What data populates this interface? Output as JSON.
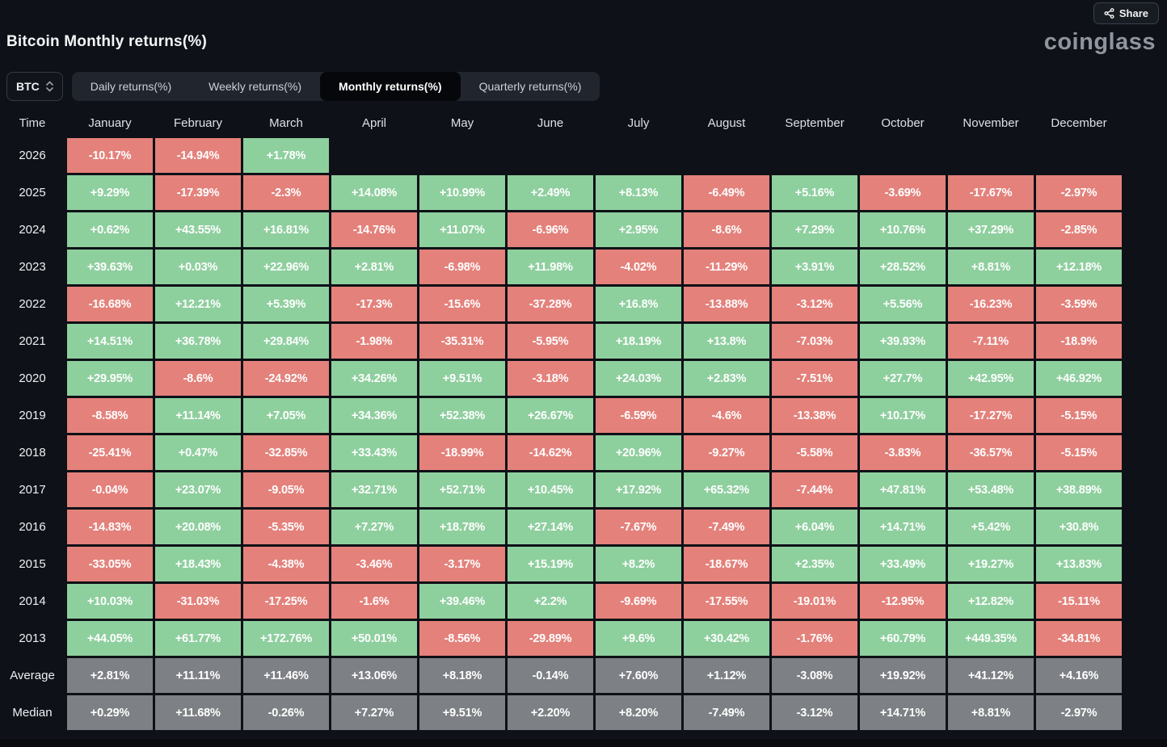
{
  "page": {
    "title": "Bitcoin Monthly returns(%)",
    "logo_text": "coinglass",
    "share_label": "Share"
  },
  "toolbar": {
    "symbol": "BTC",
    "tabs": [
      {
        "label": "Daily returns(%)",
        "slug": "daily-returns",
        "active": false
      },
      {
        "label": "Weekly returns(%)",
        "slug": "weekly-returns",
        "active": false
      },
      {
        "label": "Monthly returns(%)",
        "slug": "monthly-returns",
        "active": true
      },
      {
        "label": "Quarterly returns(%)",
        "slug": "quarterly-returns",
        "active": false
      }
    ]
  },
  "colors": {
    "positive": "#8ecf9e",
    "negative": "#e4817b",
    "summary": "#7d8084",
    "background": "#0e1117"
  },
  "chart_data": {
    "type": "heatmap",
    "title": "Bitcoin Monthly returns(%)",
    "columns": [
      "Time",
      "January",
      "February",
      "March",
      "April",
      "May",
      "June",
      "July",
      "August",
      "September",
      "October",
      "November",
      "December"
    ],
    "rows": [
      {
        "label": "2026",
        "kind": "year",
        "values": [
          "-10.17%",
          "-14.94%",
          "+1.78%",
          "",
          "",
          "",
          "",
          "",
          "",
          "",
          "",
          ""
        ]
      },
      {
        "label": "2025",
        "kind": "year",
        "values": [
          "+9.29%",
          "-17.39%",
          "-2.3%",
          "+14.08%",
          "+10.99%",
          "+2.49%",
          "+8.13%",
          "-6.49%",
          "+5.16%",
          "-3.69%",
          "-17.67%",
          "-2.97%"
        ]
      },
      {
        "label": "2024",
        "kind": "year",
        "values": [
          "+0.62%",
          "+43.55%",
          "+16.81%",
          "-14.76%",
          "+11.07%",
          "-6.96%",
          "+2.95%",
          "-8.6%",
          "+7.29%",
          "+10.76%",
          "+37.29%",
          "-2.85%"
        ]
      },
      {
        "label": "2023",
        "kind": "year",
        "values": [
          "+39.63%",
          "+0.03%",
          "+22.96%",
          "+2.81%",
          "-6.98%",
          "+11.98%",
          "-4.02%",
          "-11.29%",
          "+3.91%",
          "+28.52%",
          "+8.81%",
          "+12.18%"
        ]
      },
      {
        "label": "2022",
        "kind": "year",
        "values": [
          "-16.68%",
          "+12.21%",
          "+5.39%",
          "-17.3%",
          "-15.6%",
          "-37.28%",
          "+16.8%",
          "-13.88%",
          "-3.12%",
          "+5.56%",
          "-16.23%",
          "-3.59%"
        ]
      },
      {
        "label": "2021",
        "kind": "year",
        "values": [
          "+14.51%",
          "+36.78%",
          "+29.84%",
          "-1.98%",
          "-35.31%",
          "-5.95%",
          "+18.19%",
          "+13.8%",
          "-7.03%",
          "+39.93%",
          "-7.11%",
          "-18.9%"
        ]
      },
      {
        "label": "2020",
        "kind": "year",
        "values": [
          "+29.95%",
          "-8.6%",
          "-24.92%",
          "+34.26%",
          "+9.51%",
          "-3.18%",
          "+24.03%",
          "+2.83%",
          "-7.51%",
          "+27.7%",
          "+42.95%",
          "+46.92%"
        ]
      },
      {
        "label": "2019",
        "kind": "year",
        "values": [
          "-8.58%",
          "+11.14%",
          "+7.05%",
          "+34.36%",
          "+52.38%",
          "+26.67%",
          "-6.59%",
          "-4.6%",
          "-13.38%",
          "+10.17%",
          "-17.27%",
          "-5.15%"
        ]
      },
      {
        "label": "2018",
        "kind": "year",
        "values": [
          "-25.41%",
          "+0.47%",
          "-32.85%",
          "+33.43%",
          "-18.99%",
          "-14.62%",
          "+20.96%",
          "-9.27%",
          "-5.58%",
          "-3.83%",
          "-36.57%",
          "-5.15%"
        ]
      },
      {
        "label": "2017",
        "kind": "year",
        "values": [
          "-0.04%",
          "+23.07%",
          "-9.05%",
          "+32.71%",
          "+52.71%",
          "+10.45%",
          "+17.92%",
          "+65.32%",
          "-7.44%",
          "+47.81%",
          "+53.48%",
          "+38.89%"
        ]
      },
      {
        "label": "2016",
        "kind": "year",
        "values": [
          "-14.83%",
          "+20.08%",
          "-5.35%",
          "+7.27%",
          "+18.78%",
          "+27.14%",
          "-7.67%",
          "-7.49%",
          "+6.04%",
          "+14.71%",
          "+5.42%",
          "+30.8%"
        ]
      },
      {
        "label": "2015",
        "kind": "year",
        "values": [
          "-33.05%",
          "+18.43%",
          "-4.38%",
          "-3.46%",
          "-3.17%",
          "+15.19%",
          "+8.2%",
          "-18.67%",
          "+2.35%",
          "+33.49%",
          "+19.27%",
          "+13.83%"
        ]
      },
      {
        "label": "2014",
        "kind": "year",
        "values": [
          "+10.03%",
          "-31.03%",
          "-17.25%",
          "-1.6%",
          "+39.46%",
          "+2.2%",
          "-9.69%",
          "-17.55%",
          "-19.01%",
          "-12.95%",
          "+12.82%",
          "-15.11%"
        ]
      },
      {
        "label": "2013",
        "kind": "year",
        "values": [
          "+44.05%",
          "+61.77%",
          "+172.76%",
          "+50.01%",
          "-8.56%",
          "-29.89%",
          "+9.6%",
          "+30.42%",
          "-1.76%",
          "+60.79%",
          "+449.35%",
          "-34.81%"
        ]
      },
      {
        "label": "Average",
        "kind": "summary",
        "values": [
          "+2.81%",
          "+11.11%",
          "+11.46%",
          "+13.06%",
          "+8.18%",
          "-0.14%",
          "+7.60%",
          "+1.12%",
          "-3.08%",
          "+19.92%",
          "+41.12%",
          "+4.16%"
        ]
      },
      {
        "label": "Median",
        "kind": "summary",
        "values": [
          "+0.29%",
          "+11.68%",
          "-0.26%",
          "+7.27%",
          "+9.51%",
          "+2.20%",
          "+8.20%",
          "-7.49%",
          "-3.12%",
          "+14.71%",
          "+8.81%",
          "-2.97%"
        ]
      }
    ]
  }
}
